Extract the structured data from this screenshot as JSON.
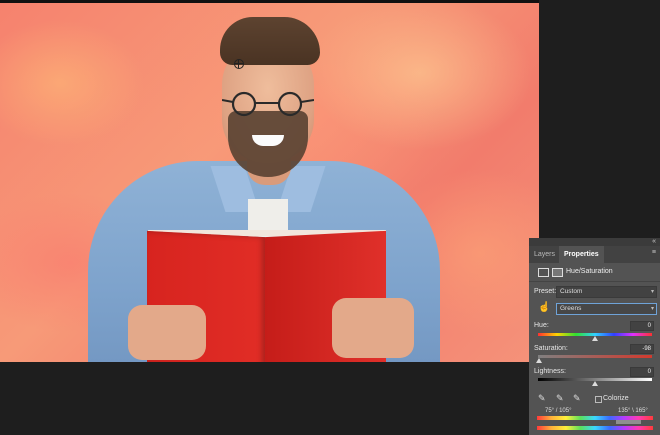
{
  "properties_panel": {
    "tabs": [
      {
        "label": "Layers",
        "active": false
      },
      {
        "label": "Properties",
        "active": true
      }
    ],
    "adjustment_title": "Hue/Saturation",
    "preset_label": "Preset:",
    "preset_value": "Custom",
    "channel_value": "Greens",
    "sliders": [
      {
        "label": "Hue:",
        "value": "0",
        "level": 0.5
      },
      {
        "label": "Saturation:",
        "value": "-98",
        "level": 0.01
      },
      {
        "label": "Lightness:",
        "value": "0",
        "level": 0.5
      }
    ],
    "colorize_label": "Colorize",
    "colorize_checked": false,
    "range_left": "75° / 105°",
    "range_right": "135° \\ 165°",
    "icons": {
      "adjustment": "hue-saturation-adjustment-icon",
      "mask": "layer-mask-icon",
      "hand": "targeted-adjustment-hand-icon",
      "droppers": [
        "eyedropper-icon",
        "eyedropper-add-icon",
        "eyedropper-subtract-icon"
      ]
    }
  },
  "colors": {
    "panel_bg": "#535353",
    "app_bg": "#1e1e1e",
    "focus_accent": "#6fa3d8",
    "book_red": "#e12d26"
  }
}
